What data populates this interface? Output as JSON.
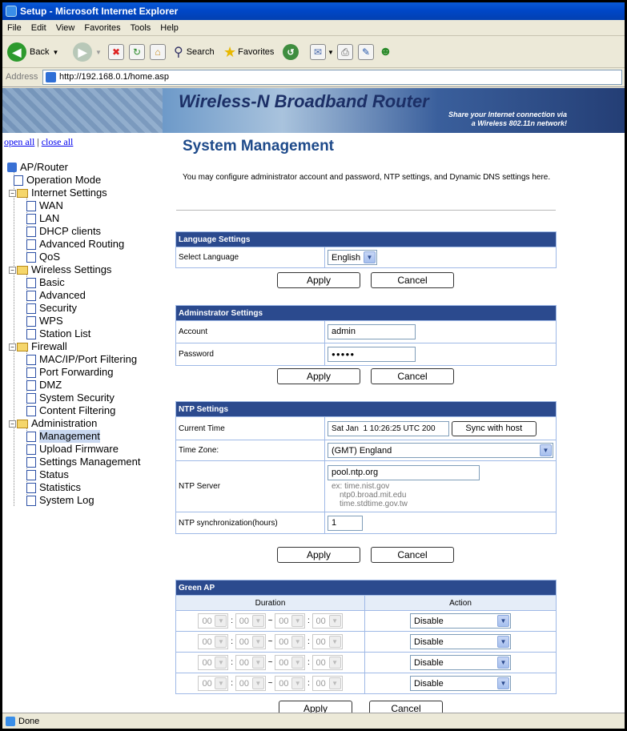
{
  "window": {
    "title": "Setup - Microsoft Internet Explorer"
  },
  "menu": [
    "File",
    "Edit",
    "View",
    "Favorites",
    "Tools",
    "Help"
  ],
  "toolbar": {
    "back": "Back",
    "search": "Search",
    "favorites": "Favorites"
  },
  "address": {
    "label": "Address",
    "url": "http://192.168.0.1/home.asp"
  },
  "banner": {
    "title": "Wireless-N Broadband Router",
    "sub1": "Share your Internet connection via",
    "sub2": "a Wireless 802.11n network!"
  },
  "tree": {
    "open_all": "open all",
    "sep": "|",
    "close_all": "close all",
    "root": "AP/Router",
    "operation_mode": "Operation Mode",
    "internet": {
      "label": "Internet Settings",
      "items": [
        "WAN",
        "LAN",
        "DHCP clients",
        "Advanced Routing",
        "QoS"
      ]
    },
    "wireless": {
      "label": "Wireless Settings",
      "items": [
        "Basic",
        "Advanced",
        "Security",
        "WPS",
        "Station List"
      ]
    },
    "firewall": {
      "label": "Firewall",
      "items": [
        "MAC/IP/Port Filtering",
        "Port Forwarding",
        "DMZ",
        "System Security",
        "Content Filtering"
      ]
    },
    "admin": {
      "label": "Administration",
      "items": [
        "Management",
        "Upload Firmware",
        "Settings Management",
        "Status",
        "Statistics",
        "System Log"
      ]
    }
  },
  "page": {
    "title": "System Management",
    "description": "You may configure administrator account and password, NTP settings, and Dynamic DNS settings here."
  },
  "language": {
    "header": "Language Settings",
    "label": "Select Language",
    "value": "English"
  },
  "admin_settings": {
    "header": "Adminstrator Settings",
    "account_label": "Account",
    "account_value": "admin",
    "password_label": "Password",
    "password_value": "●●●●●"
  },
  "ntp": {
    "header": "NTP Settings",
    "current_time_label": "Current Time",
    "current_time_value": "Sat Jan  1 10:26:25 UTC 200",
    "sync_button": "Sync with host",
    "timezone_label": "Time Zone:",
    "timezone_value": "(GMT) England",
    "server_label": "NTP Server",
    "server_value": "pool.ntp.org",
    "hint1": "ex: time.nist.gov",
    "hint2": "ntp0.broad.mit.edu",
    "hint3": "time.stdtime.gov.tw",
    "sync_label": "NTP synchronization(hours)",
    "sync_value": "1"
  },
  "green_ap": {
    "header": "Green AP",
    "duration_col": "Duration",
    "action_col": "Action",
    "time_value": "00",
    "colon": ":",
    "tilde": "~",
    "action_value": "Disable"
  },
  "buttons": {
    "apply": "Apply",
    "cancel": "Cancel"
  },
  "status": {
    "text": "Done"
  }
}
